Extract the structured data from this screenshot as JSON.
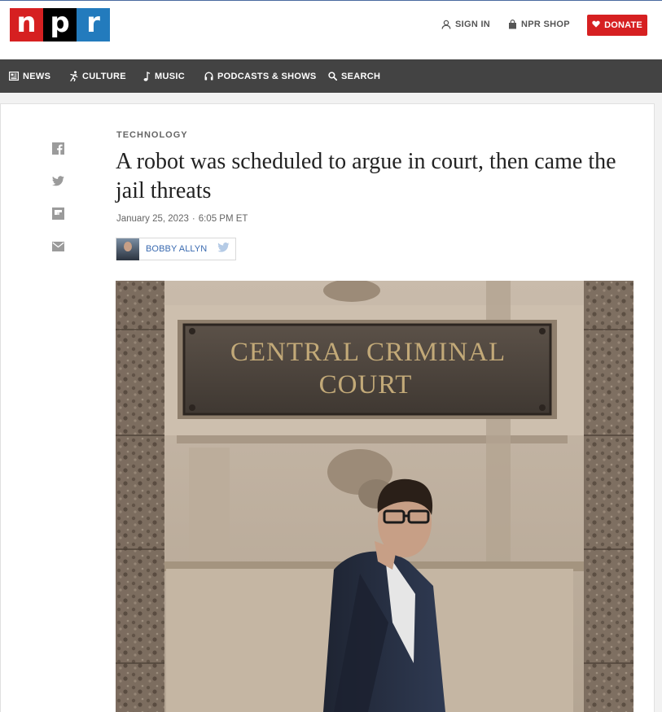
{
  "header": {
    "logo": {
      "n": "n",
      "p": "p",
      "r": "r"
    },
    "sign_in": "SIGN IN",
    "shop": "NPR SHOP",
    "donate": "DONATE"
  },
  "nav": {
    "items": [
      {
        "label": "NEWS",
        "icon": "news-icon"
      },
      {
        "label": "CULTURE",
        "icon": "culture-icon"
      },
      {
        "label": "MUSIC",
        "icon": "music-icon"
      },
      {
        "label": "PODCASTS & SHOWS",
        "icon": "headphones-icon"
      },
      {
        "label": "SEARCH",
        "icon": "search-icon"
      }
    ]
  },
  "share": [
    "facebook-icon",
    "twitter-icon",
    "flipboard-icon",
    "email-icon"
  ],
  "article": {
    "section": "TECHNOLOGY",
    "headline": "A robot was scheduled to argue in court, then came the jail threats",
    "date": "January 25, 2023",
    "time": "6:05 PM ET",
    "author": "BOBBY ALLYN",
    "photo": {
      "sign_line1": "CENTRAL CRIMINAL",
      "sign_line2": "COURT"
    }
  },
  "colors": {
    "npr_red": "#d62021",
    "npr_blue": "#237bbd",
    "nav_bg": "#434343",
    "link_blue": "#3a6ab0"
  }
}
